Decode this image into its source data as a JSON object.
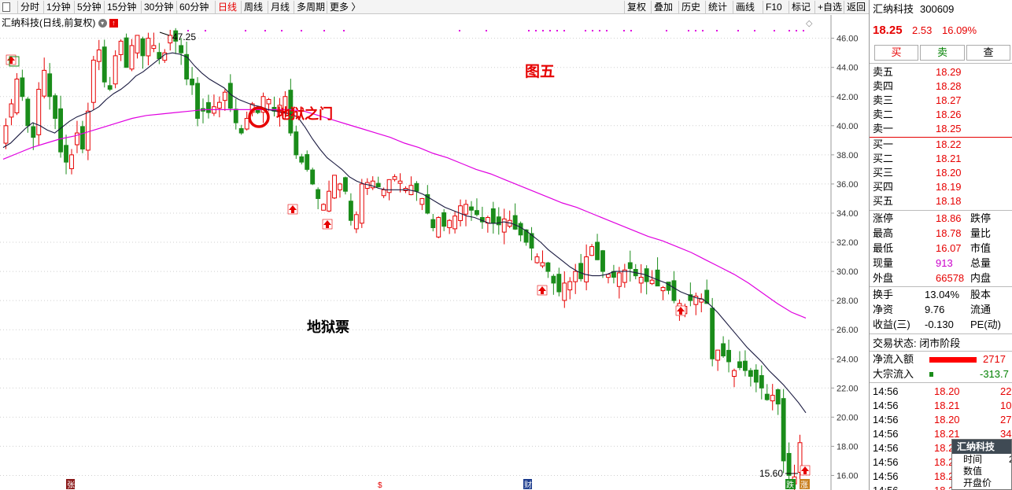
{
  "toolbar": {
    "left": [
      "分时",
      "1分钟",
      "5分钟",
      "15分钟",
      "30分钟",
      "60分钟",
      "日线",
      "周线",
      "月线",
      "多周期",
      "更多 〉"
    ],
    "right": [
      "复权",
      "叠加",
      "历史",
      "统计",
      "画线",
      "F10",
      "标记",
      "+自选",
      "返回"
    ],
    "active": "日线"
  },
  "chart": {
    "title": "汇纳科技(日线,前复权)",
    "high_label": "47.25",
    "low_label": "15.60",
    "annotations": {
      "fig": "图五",
      "gate": "地狱之门",
      "stock": "地狱票"
    },
    "bottom_markers": [
      "张",
      "$",
      "财"
    ],
    "badge_up": "涨",
    "badge_down": "跌",
    "colors": {
      "up": "#e60000",
      "down": "#1a8c1a",
      "ma_short": "#1a1a40",
      "ma_long": "#e000e0",
      "annotation": "#e60000"
    }
  },
  "chart_data": {
    "type": "candlestick",
    "ylim": [
      15.0,
      47.6
    ],
    "yticks": [
      "46.00",
      "44.00",
      "42.00",
      "40.00",
      "38.00",
      "36.00",
      "34.00",
      "32.00",
      "30.00",
      "28.00",
      "26.00",
      "24.00",
      "22.00",
      "20.00",
      "18.00",
      "16.00"
    ],
    "count": 146,
    "close": [
      40.0,
      41.5,
      43.2,
      42.0,
      40.0,
      39.2,
      42.5,
      43.8,
      42.0,
      40.5,
      38.2,
      37.5,
      38.0,
      39.5,
      38.4,
      41.0,
      44.5,
      45.2,
      43.0,
      42.5,
      44.8,
      45.8,
      44.0,
      45.5,
      46.2,
      44.8,
      46.0,
      45.5,
      44.6,
      45.0,
      46.2,
      45.8,
      45.0,
      43.2,
      42.8,
      40.5,
      41.0,
      40.9,
      41.3,
      41.6,
      42.3,
      41.2,
      40.2,
      39.5,
      40.5,
      41.5,
      40.9,
      42.0,
      41.8,
      41.0,
      41.4,
      42.0,
      39.5,
      38.0,
      37.5,
      37.0,
      36.0,
      35.0,
      34.6,
      35.5,
      36.6,
      36.0,
      35.5,
      33.5,
      33.9,
      36.0,
      36.1,
      36.2,
      35.8,
      35.6,
      36.3,
      36.5,
      36.2,
      35.7,
      35.9,
      35.5,
      35.0,
      34.0,
      33.0,
      33.7,
      33.1,
      33.5,
      33.8,
      34.5,
      34.6,
      34.2,
      33.9,
      33.4,
      33.7,
      33.3,
      33.2,
      33.6,
      33.5,
      32.9,
      32.5,
      32.0,
      31.6,
      31.0,
      30.6,
      30.0,
      29.2,
      28.6,
      29.2,
      29.3,
      30.0,
      29.5,
      31.0,
      31.7,
      30.8,
      30.0,
      29.8,
      29.6,
      29.9,
      30.1,
      30.2,
      29.7,
      29.6,
      29.3,
      29.4,
      29.0,
      28.9,
      28.7,
      28.0,
      27.8,
      27.6,
      28.0,
      28.3,
      28.1,
      27.8,
      24.0,
      24.6,
      24.2,
      23.8,
      23.2,
      23.4,
      23.2,
      22.8,
      22.4,
      22.0,
      21.2,
      21.5,
      20.9,
      17.0,
      16.0,
      15.9,
      18.25
    ],
    "ma_short": [
      38.5,
      38.8,
      39.3,
      39.8,
      40.2,
      40.0,
      39.7,
      39.5,
      39.9,
      40.3,
      40.6,
      40.8,
      41.0,
      41.3,
      41.8,
      42.2,
      42.5,
      42.9,
      43.4,
      43.7,
      44.1,
      44.5,
      44.9,
      45.0,
      44.9,
      44.7,
      44.1,
      43.6,
      43.2,
      42.9,
      42.6,
      42.1,
      41.8,
      41.6,
      41.4,
      41.3,
      41.1,
      41.0,
      40.9,
      40.8,
      40.6,
      39.9,
      39.1,
      38.4,
      37.8,
      37.4,
      37.0,
      36.5,
      36.2,
      36.0,
      35.9,
      35.7,
      35.6,
      35.6,
      35.6,
      35.6,
      35.5,
      35.3,
      35.0,
      34.7,
      34.4,
      34.2,
      34.0,
      33.8,
      33.7,
      33.5,
      33.3,
      33.3,
      33.4,
      33.3,
      33.1,
      32.8,
      32.4,
      32.0,
      31.5,
      31.1,
      30.7,
      30.3,
      30.0,
      29.8,
      29.7,
      29.7,
      29.8,
      30.0,
      30.0,
      30.0,
      29.9,
      29.8,
      29.6,
      29.4,
      29.2,
      28.9,
      28.6,
      28.4,
      28.2,
      28.1,
      27.7,
      27.2,
      26.6,
      26.0,
      25.4,
      24.8,
      24.3,
      23.8,
      23.2,
      22.7,
      22.2,
      21.6,
      21.0,
      20.3
    ],
    "ma_long": [
      37.7,
      38.1,
      38.5,
      38.8,
      39.1,
      39.3,
      39.6,
      39.9,
      40.2,
      40.5,
      40.7,
      40.8,
      40.9,
      41.0,
      41.1,
      41.1,
      41.1,
      41.1,
      41.1,
      41.1,
      41.1,
      41.0,
      40.7,
      40.4,
      40.1,
      39.8,
      39.5,
      39.2,
      38.8,
      38.5,
      38.1,
      37.8,
      37.4,
      37.0,
      36.7,
      36.3,
      35.9,
      35.5,
      35.1,
      34.7,
      34.4,
      34.0,
      33.6,
      33.2,
      32.8,
      32.4,
      32.1,
      31.7,
      31.3,
      30.8,
      30.3,
      29.8,
      29.2,
      28.5,
      27.8,
      27.2,
      26.8
    ]
  },
  "quote": {
    "name": "汇纳科技",
    "code": "300609",
    "price": "18.25",
    "change": "2.53",
    "pct": "16.09%",
    "buy_label": "买",
    "sell_label": "卖",
    "query_label": "查",
    "sells": [
      {
        "label": "卖五",
        "price": "18.29"
      },
      {
        "label": "卖四",
        "price": "18.28"
      },
      {
        "label": "卖三",
        "price": "18.27"
      },
      {
        "label": "卖二",
        "price": "18.26"
      },
      {
        "label": "卖一",
        "price": "18.25"
      }
    ],
    "buys": [
      {
        "label": "买一",
        "price": "18.22"
      },
      {
        "label": "买二",
        "price": "18.21"
      },
      {
        "label": "买三",
        "price": "18.20"
      },
      {
        "label": "买四",
        "price": "18.19"
      },
      {
        "label": "买五",
        "price": "18.18"
      }
    ],
    "stats": [
      {
        "l": "涨停",
        "v": "18.86",
        "l2": "跌停",
        "c": "red"
      },
      {
        "l": "最高",
        "v": "18.78",
        "l2": "量比",
        "c": "red"
      },
      {
        "l": "最低",
        "v": "16.07",
        "l2": "市值",
        "c": "red"
      },
      {
        "l": "现量",
        "v": "913",
        "l2": "总量",
        "c": "magenta"
      },
      {
        "l": "外盘",
        "v": "66578",
        "l2": "内盘",
        "c": "red"
      }
    ],
    "stats2": [
      {
        "l": "换手",
        "v": "13.04%",
        "l2": "股本"
      },
      {
        "l": "净资",
        "v": "9.76",
        "l2": "流通"
      },
      {
        "l": "收益(三)",
        "v": "-0.130",
        "l2": "PE(动)"
      }
    ],
    "status_label": "交易状态: 闭市阶段",
    "netflow_label": "净流入额",
    "netflow_val": "2717",
    "bigflow_label": "大宗流入",
    "bigflow_val": "-313.7",
    "ticks": [
      {
        "t": "14:56",
        "p": "18.20",
        "v": "22"
      },
      {
        "t": "14:56",
        "p": "18.21",
        "v": "10"
      },
      {
        "t": "14:56",
        "p": "18.20",
        "v": "27"
      },
      {
        "t": "14:56",
        "p": "18.21",
        "v": "34"
      },
      {
        "t": "14:56",
        "p": "18.2",
        "v": ""
      },
      {
        "t": "14:56",
        "p": "18.2",
        "v": ""
      },
      {
        "t": "14:56",
        "p": "18.2",
        "v": ""
      },
      {
        "t": "14:56",
        "p": "18.2",
        "v": ""
      }
    ]
  },
  "tooltip": {
    "title": "汇纳科技",
    "rows": [
      {
        "l": "时间",
        "v": "2"
      },
      {
        "l": "数值",
        "v": ""
      },
      {
        "l": "开盘价",
        "v": ""
      }
    ]
  }
}
